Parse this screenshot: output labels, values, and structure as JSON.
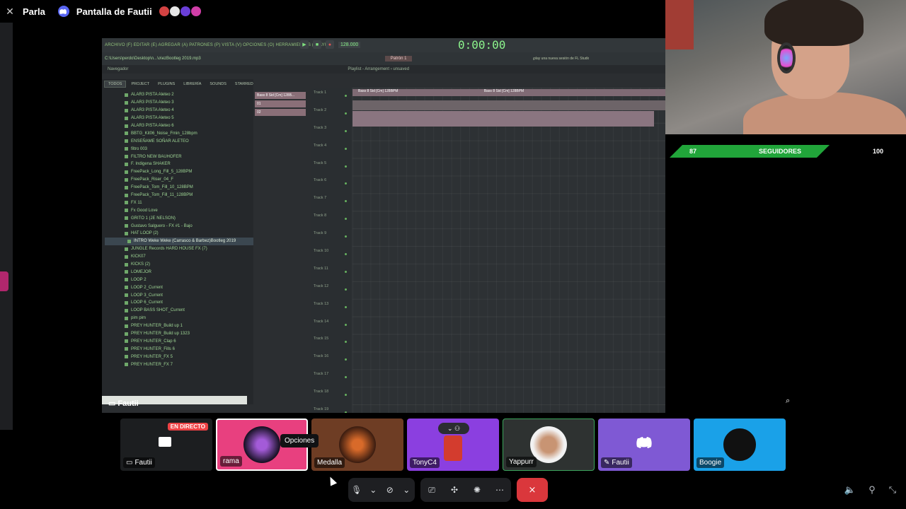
{
  "topbar": {
    "parla_label": "Parla",
    "stream_title": "Pantalla de Fautii",
    "icons": [
      "close-icon",
      "discord-icon"
    ]
  },
  "fl_studio": {
    "menu_text": "ARCHIVO (F)  EDITAR (E)  AGREGAR (A)  PATRONES (P)  VISTA (V)  OPCIONES (O)  HERRAMIENTAS (T)  AYUDA",
    "tempo": "128.000",
    "time_display": "0:00:00",
    "file_path": "C:\\Users\\perdo\\Desktop\\n...\\o\\ezBootleg 2019.mp3",
    "pattern_label": "Patrón 1",
    "hint_text": "¡play una nueva sesión de FL Studio está d...",
    "browser_title": "Navegador",
    "playlist_title": "Playlist - Arrangement › unsaved",
    "browser_tabs": [
      "TODOS",
      "PROJECT",
      "PLUGINS",
      "LIBRERÍA",
      "SOUNDS",
      "STARRED"
    ],
    "browser_items": [
      "ALAR3 PISTA Aleteo 2",
      "ALAR3 PISTA Aleteo 3",
      "ALAR3 PISTA Aleteo 4",
      "ALAR3 PISTA Aleteo 5",
      "ALAR3 PISTA Aleteo 6",
      "BBTG_Kit06_Noise_Fmin_128bpm",
      "ENSEÑAME SOÑAR ALETEO",
      "filtro 003",
      "FILTRO NEW BAUHOFER",
      "F. Indigena SHAKER",
      "FreePack_Long_Fill_5_128BPM",
      "FreePack_Riser_04_F",
      "FreePack_Tom_Fill_10_128BPM",
      "FreePack_Tom_Fill_11_128BPM",
      "FX 11",
      "Fx Good Love",
      "GRITO 1 (JE NELSON)",
      "Gustavo Salguero - FX #1 - Bajo",
      "HAT LOOP (2)",
      "INTRO Weke Weke (Carrasco & Barbez)Bootleg 2019",
      "JUNGLE Records HARD HOUSE FX (7)",
      "KICK07",
      "KICKS (2)",
      "LOMEJOR",
      "LOOP 2",
      "LOOP 2_Current",
      "LOOP 3_Current",
      "LOOP 6_Current",
      "LOOP BASS SHOT_Current",
      "pim pim",
      "PREY HUNTER_Build up 1",
      "PREY HUNTER_Build up 1323",
      "PREY HUNTER_Clap 6",
      "PREY HUNTER_Fills 6",
      "PREY HUNTER_FX 5",
      "PREY HUNTER_FX 7"
    ],
    "selected_item_index": 19,
    "channels": [
      "Bass 8 Sid [Cm] 128B...",
      "01",
      "02"
    ],
    "tracks": [
      "Track 1",
      "Track 2",
      "Track 3",
      "Track 4",
      "Track 5",
      "Track 6",
      "Track 7",
      "Track 8",
      "Track 9",
      "Track 10",
      "Track 11",
      "Track 12",
      "Track 13",
      "Track 14",
      "Track 15",
      "Track 16",
      "Track 17",
      "Track 18",
      "Track 19"
    ],
    "clip_label": "Bass 8 Sid [Cm] 128BPM",
    "clip_label_2": "Bass 8 Sid [Cm] 128BPM"
  },
  "stream_overlay": {
    "followers_current": "87",
    "followers_label": "SEGUIDORES",
    "followers_goal": "100",
    "streamer_label": "Fautii"
  },
  "participants": [
    {
      "name": "Fautii",
      "badge": "EN DIRECTO",
      "color": "#1c1e20"
    },
    {
      "name": "rama",
      "color": "#e8407f"
    },
    {
      "name": "Medalla",
      "color": "#6e3d24"
    },
    {
      "name": "TonyC4",
      "color": "#8b3fe0"
    },
    {
      "name": "Yappurr",
      "color": "#2e3231"
    },
    {
      "name": "Fautii",
      "color": "#7f59d4"
    },
    {
      "name": "Boogie",
      "color": "#1aa1e8"
    }
  ],
  "tooltip": "Opciones",
  "controls": {
    "icons": [
      "microphone-icon",
      "chevron-down-icon",
      "camera-off-icon",
      "chevron-down-icon",
      "screen-share-icon",
      "activities-icon",
      "soundboard-icon",
      "more-icon",
      "hang-up-icon"
    ],
    "right_icons": [
      "volume-icon",
      "pin-icon",
      "exit-fullscreen-icon"
    ]
  }
}
